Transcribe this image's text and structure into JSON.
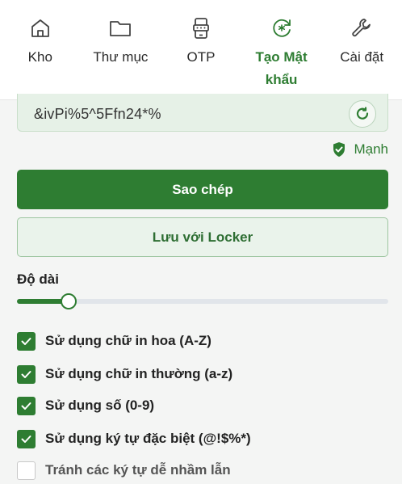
{
  "nav": {
    "items": [
      {
        "label": "Kho",
        "icon": "home-icon"
      },
      {
        "label": "Thư mục",
        "icon": "folder-icon"
      },
      {
        "label": "OTP",
        "icon": "otp-device-icon"
      },
      {
        "label": "Tạo Mật khẩu",
        "icon": "generate-password-icon",
        "active": true
      },
      {
        "label": "Cài đặt",
        "icon": "wrench-icon"
      }
    ]
  },
  "generator": {
    "password": "&ivPi%5^5Ffn24*%",
    "strength": "Mạnh",
    "copy_label": "Sao chép",
    "save_label": "Lưu với Locker",
    "length_label": "Độ dài",
    "length_progress": 0.14
  },
  "options": [
    {
      "label": "Sử dụng chữ in hoa (A-Z)",
      "checked": true
    },
    {
      "label": "Sử dụng chữ in thường (a-z)",
      "checked": true
    },
    {
      "label": "Sử dụng số (0-9)",
      "checked": true
    },
    {
      "label": "Sử dụng ký tự đặc biệt (@!$%*)",
      "checked": true
    },
    {
      "label": "Tránh các ký tự dễ nhầm lẫn",
      "checked": false
    }
  ],
  "colors": {
    "accent": "#2e7d32",
    "accent_light": "#e6f1e7"
  }
}
